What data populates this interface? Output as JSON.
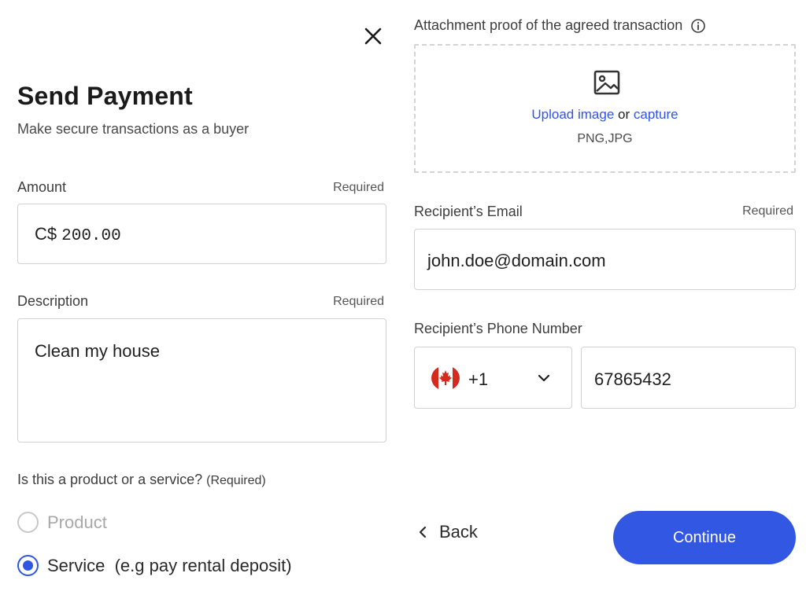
{
  "header": {
    "close_icon": "close-icon",
    "title": "Send Payment",
    "subtitle": "Make secure transactions as a buyer"
  },
  "amount": {
    "label": "Amount",
    "required": "Required",
    "currency": "C$",
    "value": "200.00"
  },
  "description": {
    "label": "Description",
    "required": "Required",
    "value": "Clean my house"
  },
  "type_question": {
    "label": "Is this a product or a service?",
    "required": "(Required)",
    "options": [
      {
        "label": "Product",
        "selected": false,
        "disabled": true
      },
      {
        "label": "Service  (e.g pay rental deposit)",
        "selected": true,
        "disabled": false
      }
    ]
  },
  "attachment": {
    "label": "Attachment proof of the agreed transaction",
    "info_icon": "info-icon",
    "image_icon": "image-icon",
    "upload_link": "Upload image",
    "or_text": "or",
    "capture_link": "capture",
    "formats": "PNG,JPG"
  },
  "recipient_email": {
    "label": "Recipient’s Email",
    "required": "Required",
    "value": "john.doe@domain.com"
  },
  "recipient_phone": {
    "label": "Recipient’s Phone Number",
    "country_flag": "canada-flag-icon",
    "dial_code": "+1",
    "value": "67865432"
  },
  "footer": {
    "back_label": "Back",
    "continue_label": "Continue"
  },
  "colors": {
    "accent": "#3157e3",
    "link": "#2f55e4",
    "border": "#d2d2d2",
    "flag_red": "#d52b1e"
  }
}
